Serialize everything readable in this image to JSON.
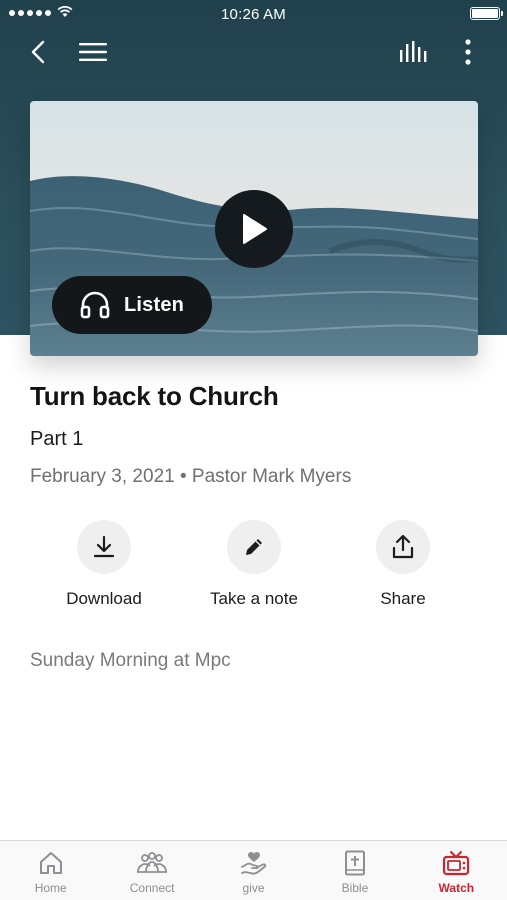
{
  "status_bar": {
    "time": "10:26 AM"
  },
  "navbar": {
    "back_icon": "chevron-left-icon",
    "menu_icon": "hamburger-icon",
    "audio_icon": "audio-levels-icon",
    "more_icon": "vertical-dots-icon"
  },
  "media": {
    "play_icon": "play-icon",
    "listen_label": "Listen",
    "listen_icon": "headphones-icon"
  },
  "sermon": {
    "title": "Turn back to Church",
    "subtitle": "Part 1",
    "meta": "February 3, 2021 • Pastor Mark Myers",
    "series": "Sunday Morning at Mpc"
  },
  "actions": [
    {
      "label": "Download",
      "icon": "download-icon"
    },
    {
      "label": "Take a note",
      "icon": "pencil-icon"
    },
    {
      "label": "Share",
      "icon": "share-icon"
    }
  ],
  "tabs": [
    {
      "label": "Home",
      "icon": "home-icon",
      "active": false
    },
    {
      "label": "Connect",
      "icon": "people-icon",
      "active": false
    },
    {
      "label": "give",
      "icon": "giving-hand-icon",
      "active": false
    },
    {
      "label": "Bible",
      "icon": "bible-icon",
      "active": false
    },
    {
      "label": "Watch",
      "icon": "tv-icon",
      "active": true
    }
  ],
  "colors": {
    "header_bg": "#2b4f5b",
    "active_tab": "#c8262f",
    "inactive_tab": "#8e8e93"
  }
}
